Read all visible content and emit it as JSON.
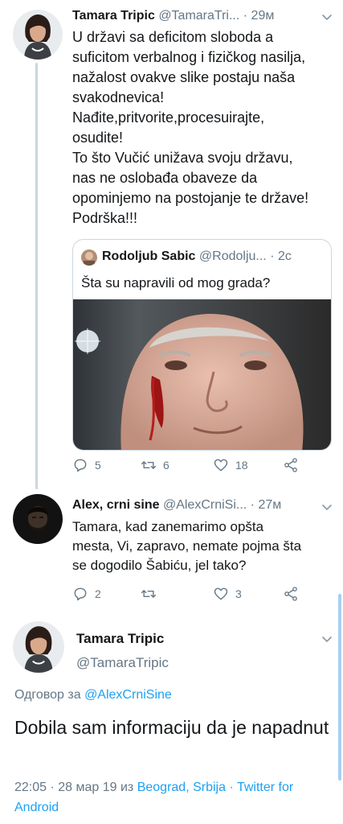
{
  "tweet1": {
    "name": "Tamara Tripic",
    "handle": "@TamaraTri...",
    "time": "· 29м",
    "text": "U državi sa deficitom sloboda a\nsuficitom verbalnog i fizičkog nasilja,\nnažalost ovakve slike postaju naša\nsvakodnevica!\nNađite,pritvorite,procesuirajte,\nosudite!\nTo što Vučić unižava svoju državu,\nnas ne oslobađa obaveze da\nopominjemo na postojanje te države!\nPodrška!!!",
    "quote": {
      "name": "Rodoljub Sabic",
      "handle": "@Rodolju...",
      "time": "· 2с",
      "text": "Šta su napravili od mog grada?"
    },
    "actions": {
      "replies": "5",
      "retweets": "6",
      "likes": "18"
    }
  },
  "tweet2": {
    "name": "Alex, crni sine",
    "handle": "@AlexCrniSi...",
    "time": "· 27м",
    "text": "Tamara, kad zanemarimo opšta\nmesta, Vi, zapravo, nemate pojma šta\nse dogodilo Šabiću, jel tako?",
    "actions": {
      "replies": "2",
      "likes": "3"
    }
  },
  "focus": {
    "name": "Tamara Tripic",
    "handle": "@TamaraTripic",
    "reply_prefix": "Одговор за ",
    "reply_to": "@AlexCrniSine",
    "text": "Dobila sam informaciju da je napadnut",
    "meta_time": "22:05 · 28 мар 19 из ",
    "meta_location": "Beograd, Srbija",
    "meta_sep": " · ",
    "meta_client": "Twitter for Android"
  },
  "icons": [
    "reply-icon",
    "retweet-icon",
    "like-icon",
    "share-icon",
    "chevron-down-icon"
  ],
  "colors": {
    "link": "#1da1f2",
    "muted": "#657786",
    "text": "#14171a",
    "border": "#ccd6dd"
  }
}
